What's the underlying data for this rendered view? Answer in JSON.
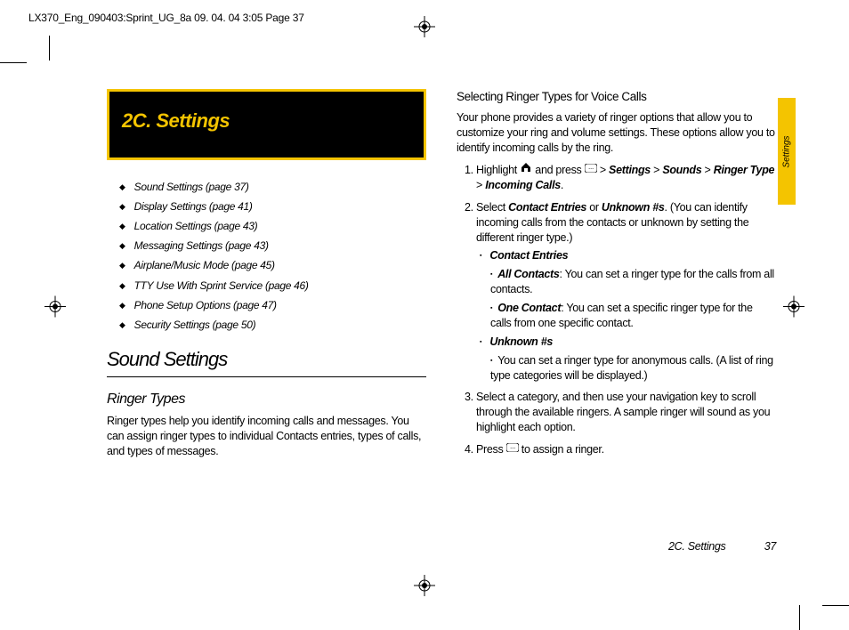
{
  "meta": {
    "headerLine": "LX370_Eng_090403:Sprint_UG_8a  09. 04. 04   3:05  Page 37"
  },
  "sideTab": "Settings",
  "sectionHeader": "2C. Settings",
  "toc": [
    "Sound Settings (page 37)",
    "Display Settings (page 41)",
    "Location Settings (page 43)",
    "Messaging Settings (page 43)",
    "Airplane/Music Mode (page 45)",
    "TTY Use With Sprint Service (page 46)",
    "Phone Setup Options (page 47)",
    "Security Settings (page 50)"
  ],
  "left": {
    "h1": "Sound Settings",
    "h2": "Ringer Types",
    "p1": "Ringer types help you identify incoming calls and messages. You can assign ringer types to individual Contacts entries, types of calls, and types of messages."
  },
  "right": {
    "h3": "Selecting Ringer Types for Voice Calls",
    "intro": "Your phone provides a variety of ringer options that allow you to customize your ring and volume settings. These options allow you to identify incoming calls by the ring.",
    "step1_a": "Highlight ",
    "step1_b": " and press ",
    "step1_c": " > ",
    "step1_path": [
      "Settings",
      "Sounds",
      "Ringer Type",
      "Incoming Calls"
    ],
    "step1_end": ".",
    "step2_a": "Select ",
    "step2_b": "Contact Entries",
    "step2_c": " or ",
    "step2_d": "Unknown #s",
    "step2_e": ". (You can identify incoming calls from the contacts or unknown by setting the different ringer type.)",
    "ce_label": "Contact Entries",
    "ce_all_label": "All Contacts",
    "ce_all_text": ":  You can set a ringer type for the calls  from all contacts.",
    "ce_one_label": "One Contact",
    "ce_one_text": ":  You can set a specific ringer type for the calls from one specific contact.",
    "unk_label": "Unknown #s",
    "unk_text": "You can set a ringer type for anonymous calls. (A list of ring type categories will be displayed.)",
    "step3": "Select a category, and then use your navigation key to scroll through the available ringers. A sample ringer will sound as you highlight each option.",
    "step4_a": "Press ",
    "step4_b": " to assign a ringer."
  },
  "footer": {
    "section": "2C. Settings",
    "page": "37"
  }
}
